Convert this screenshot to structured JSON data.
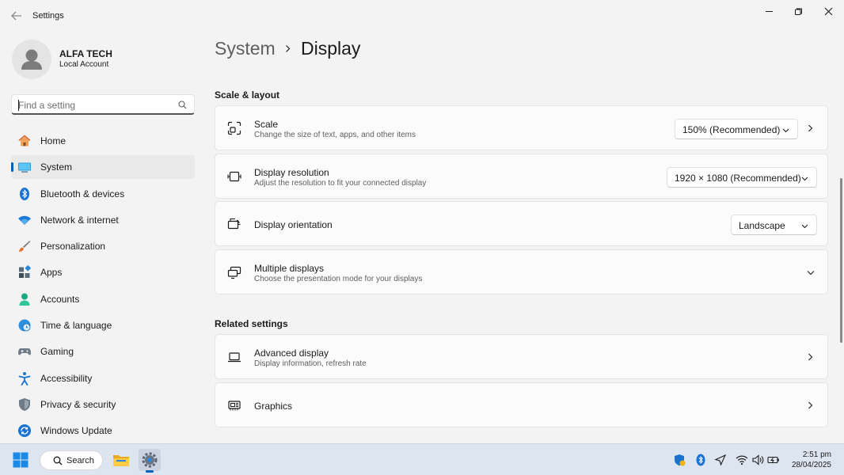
{
  "window": {
    "title": "Settings"
  },
  "user": {
    "name": "ALFA TECH",
    "account_type": "Local Account"
  },
  "search": {
    "placeholder": "Find a setting"
  },
  "nav": {
    "items": [
      {
        "label": "Home",
        "icon": "home-icon"
      },
      {
        "label": "System",
        "icon": "system-icon",
        "active": true
      },
      {
        "label": "Bluetooth & devices",
        "icon": "bluetooth-icon"
      },
      {
        "label": "Network & internet",
        "icon": "wifi-icon"
      },
      {
        "label": "Personalization",
        "icon": "brush-icon"
      },
      {
        "label": "Apps",
        "icon": "apps-icon"
      },
      {
        "label": "Accounts",
        "icon": "accounts-icon"
      },
      {
        "label": "Time & language",
        "icon": "globe-clock-icon"
      },
      {
        "label": "Gaming",
        "icon": "gamepad-icon"
      },
      {
        "label": "Accessibility",
        "icon": "accessibility-icon"
      },
      {
        "label": "Privacy & security",
        "icon": "shield-icon"
      },
      {
        "label": "Windows Update",
        "icon": "update-icon"
      }
    ]
  },
  "breadcrumb": {
    "parent": "System",
    "current": "Display"
  },
  "sections": {
    "scale_layout": "Scale & layout",
    "related": "Related settings"
  },
  "cards": {
    "scale": {
      "title": "Scale",
      "subtitle": "Change the size of text, apps, and other items",
      "value": "150% (Recommended)"
    },
    "resolution": {
      "title": "Display resolution",
      "subtitle": "Adjust the resolution to fit your connected display",
      "value": "1920 × 1080 (Recommended)"
    },
    "orientation": {
      "title": "Display orientation",
      "value": "Landscape"
    },
    "multiple": {
      "title": "Multiple displays",
      "subtitle": "Choose the presentation mode for your displays"
    },
    "advanced": {
      "title": "Advanced display",
      "subtitle": "Display information, refresh rate"
    },
    "graphics": {
      "title": "Graphics"
    }
  },
  "taskbar": {
    "search_label": "Search",
    "time": "2:51 pm",
    "date": "28/04/2025"
  },
  "colors": {
    "accent": "#005fb8",
    "background": "#f3f3f3",
    "card": "#fbfbfb",
    "taskbar": "#dde5f0"
  }
}
